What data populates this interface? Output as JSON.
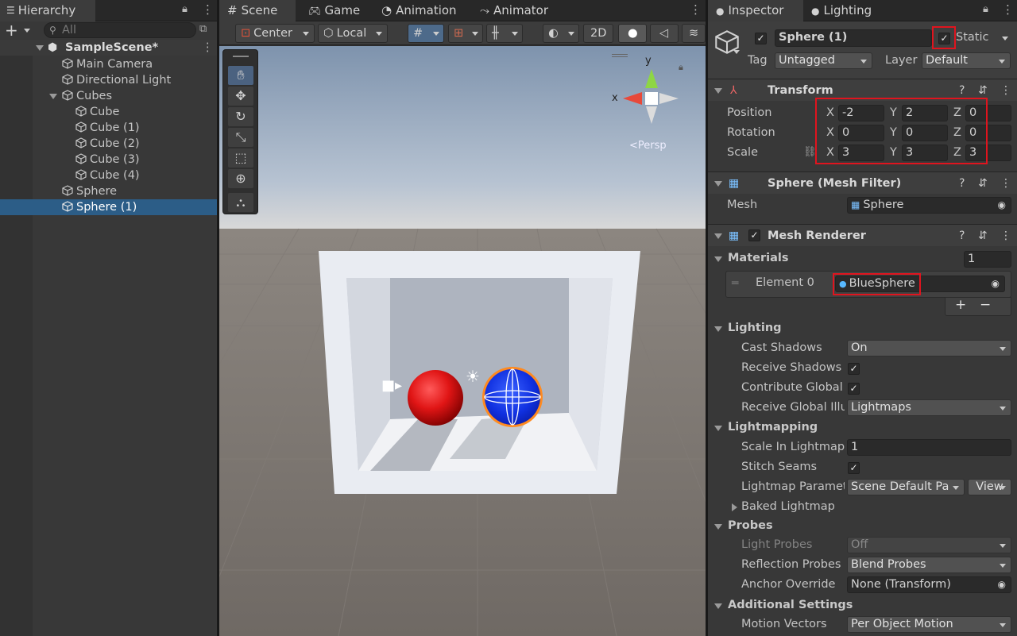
{
  "hierarchy": {
    "tab_label": "Hierarchy",
    "search_placeholder": "All",
    "add_label": "+",
    "scene_name": "SampleScene*",
    "items": [
      {
        "label": "Main Camera"
      },
      {
        "label": "Directional Light"
      },
      {
        "label": "Cubes"
      },
      {
        "label": "Cube"
      },
      {
        "label": "Cube (1)"
      },
      {
        "label": "Cube (2)"
      },
      {
        "label": "Cube (3)"
      },
      {
        "label": "Cube (4)"
      },
      {
        "label": "Sphere"
      },
      {
        "label": "Sphere (1)"
      }
    ]
  },
  "scene_view": {
    "tabs": [
      {
        "label": "Scene"
      },
      {
        "label": "Game"
      },
      {
        "label": "Animation"
      },
      {
        "label": "Animator"
      }
    ],
    "toolbar": {
      "pivot": "Center",
      "space": "Local",
      "mode_2d": "2D"
    },
    "gizmo_label": "Persp",
    "axis_x": "x",
    "axis_y": "y"
  },
  "inspector": {
    "tabs": [
      {
        "label": "Inspector"
      },
      {
        "label": "Lighting"
      }
    ],
    "object_name": "Sphere (1)",
    "static_label": "Static",
    "tag_label": "Tag",
    "tag_value": "Untagged",
    "layer_label": "Layer",
    "layer_value": "Default",
    "transform": {
      "title": "Transform",
      "position_label": "Position",
      "rotation_label": "Rotation",
      "scale_label": "Scale",
      "x": "X",
      "y": "Y",
      "z": "Z",
      "position": [
        "-2",
        "2",
        "0"
      ],
      "rotation": [
        "0",
        "0",
        "0"
      ],
      "scale": [
        "3",
        "3",
        "3"
      ]
    },
    "mesh_filter": {
      "title": "Sphere (Mesh Filter)",
      "mesh_label": "Mesh",
      "mesh_value": "Sphere"
    },
    "mesh_renderer": {
      "title": "Mesh Renderer",
      "materials_label": "Materials",
      "materials_count": "1",
      "element_label": "Element 0",
      "element_value": "BlueSphere",
      "plus": "+",
      "minus": "−",
      "lighting": {
        "title": "Lighting",
        "cast_shadows_label": "Cast Shadows",
        "cast_shadows_value": "On",
        "receive_shadows_label": "Receive Shadows",
        "contribute_gi_label": "Contribute Global",
        "receive_gi_label": "Receive Global Illu",
        "receive_gi_value": "Lightmaps"
      },
      "lightmapping": {
        "title": "Lightmapping",
        "scale_label": "Scale In Lightmap",
        "scale_value": "1",
        "stitch_label": "Stitch Seams",
        "params_label": "Lightmap Paramet",
        "params_value": "Scene Default Pa",
        "view_label": "View",
        "baked_label": "Baked Lightmap"
      },
      "probes": {
        "title": "Probes",
        "light_probes_label": "Light Probes",
        "light_probes_value": "Off",
        "reflection_label": "Reflection Probes",
        "reflection_value": "Blend Probes",
        "anchor_label": "Anchor Override",
        "anchor_value": "None (Transform)"
      },
      "additional": {
        "title": "Additional Settings",
        "motion_label": "Motion Vectors",
        "motion_value": "Per Object Motion"
      }
    }
  },
  "colors": {
    "selection": "#2c5d87",
    "highlight_red": "#e0141e",
    "panel_bg": "#383838"
  }
}
